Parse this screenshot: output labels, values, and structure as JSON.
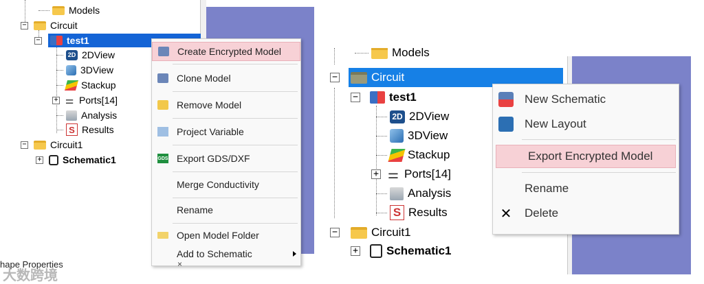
{
  "left": {
    "tree": {
      "models": "Models",
      "circuit": "Circuit",
      "test1": "test1",
      "view2d": "2DView",
      "view3d": "3DView",
      "stackup": "Stackup",
      "ports": "Ports[14]",
      "analysis": "Analysis",
      "results": "Results",
      "circuit1": "Circuit1",
      "schematic1": "Schematic1"
    },
    "menu": [
      {
        "label": "Create Encrypted Model",
        "icon": "encrypted-model-icon"
      },
      {
        "label": "Clone Model",
        "icon": "clone-model-icon"
      },
      {
        "label": "Remove Model",
        "icon": "remove-model-icon"
      },
      {
        "label": "Project Variable",
        "icon": "project-variable-icon"
      },
      {
        "label": "Export GDS/DXF",
        "icon": "gds-icon",
        "icon_text": "GDS"
      },
      {
        "label": "Merge Conductivity"
      },
      {
        "label": "Rename"
      },
      {
        "label": "Open Model Folder",
        "icon": "folder-icon"
      },
      {
        "label": "Add to Schematic",
        "has_submenu": true
      }
    ],
    "properties_label": "hape Properties",
    "properties_close": "×",
    "watermark": "大数跨境"
  },
  "right": {
    "tree": {
      "models": "Models",
      "circuit": "Circuit",
      "test1": "test1",
      "view2d": "2DView",
      "view3d": "3DView",
      "stackup": "Stackup",
      "ports": "Ports[14]",
      "analysis": "Analysis",
      "results": "Results",
      "circuit1": "Circuit1",
      "schematic1": "Schematic1"
    },
    "menu": [
      {
        "label": "New Schematic",
        "icon": "new-schematic-icon"
      },
      {
        "label": "New Layout",
        "icon": "new-layout-icon"
      },
      {
        "label": "Export Encrypted Model"
      },
      {
        "label": "Rename"
      },
      {
        "label": "Delete",
        "icon": "delete-icon",
        "icon_text": "✕"
      }
    ]
  },
  "icon_text": {
    "view2d": "2D",
    "results": "S",
    "expand": "+",
    "collapse": "−"
  },
  "colors": {
    "selection": "#1464d6",
    "highlight": "#f7d1d6",
    "background_blue": "#7b82c9"
  }
}
